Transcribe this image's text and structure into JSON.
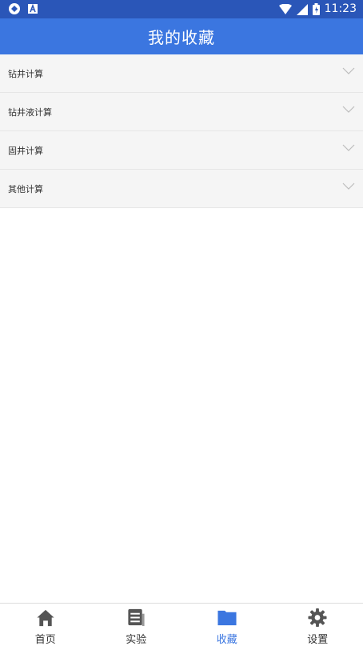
{
  "status_bar": {
    "time": "11:23"
  },
  "app_bar": {
    "title": "我的收藏"
  },
  "categories": [
    {
      "label": "钻井计算"
    },
    {
      "label": "钻井液计算"
    },
    {
      "label": "固井计算"
    },
    {
      "label": "其他计算"
    }
  ],
  "bottom_nav": {
    "items": [
      {
        "label": "首页",
        "icon": "home-icon"
      },
      {
        "label": "实验",
        "icon": "document-icon"
      },
      {
        "label": "收藏",
        "icon": "folder-icon",
        "active": true
      },
      {
        "label": "设置",
        "icon": "gear-icon"
      }
    ]
  },
  "colors": {
    "status_bar": "#2a56b8",
    "app_bar": "#3b76e0",
    "active_nav": "#3b76e0",
    "inactive_icon": "#555555"
  }
}
